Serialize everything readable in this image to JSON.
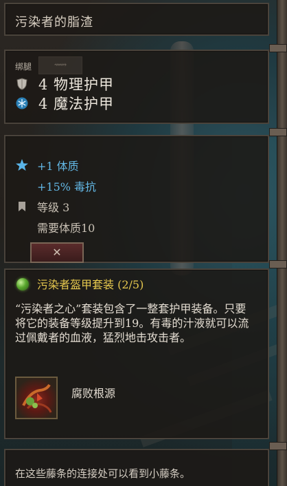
{
  "item": {
    "name": "污染者的脂渣",
    "slot_type": "绑腿"
  },
  "armor": [
    {
      "icon": "shield-icon",
      "text": "4 物理护甲"
    },
    {
      "icon": "snowflake-icon",
      "text": "4 魔法护甲"
    }
  ],
  "stats": {
    "bonus1": "+1 体质",
    "bonus2": "+15% 毒抗",
    "level": "等级 3",
    "requirement": "需要体质10"
  },
  "cancel_button": "✕",
  "set": {
    "title": "污染者盔甲套装 (2/5)",
    "description": "“污染者之心”套装包含了一整套护甲装备。只要将它的装备等级提升到19。有毒的汁液就可以流过佩戴者的血液，猛烈地击攻击者。",
    "bonus_skill": "腐败根源"
  },
  "lore": "在这些藤条的连接处可以看到小藤条。",
  "colors": {
    "set_title": "#e6c84e",
    "stat_blue": "#63b8e6",
    "text": "#e4ddd2"
  }
}
